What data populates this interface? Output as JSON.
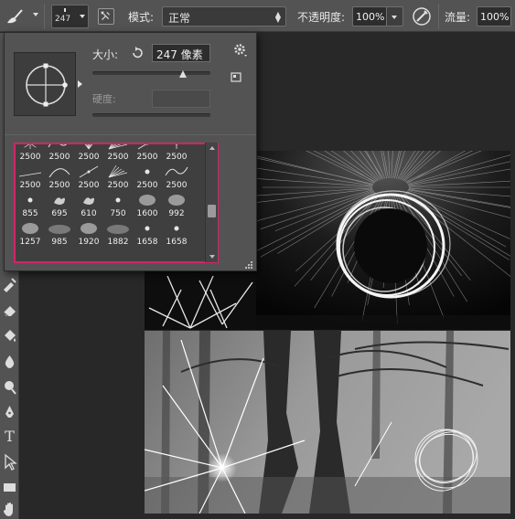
{
  "options_bar": {
    "tool_icon": "brush-icon",
    "brush_size": "247",
    "toggle_icon": "brush-panel-icon",
    "mode_label": "模式:",
    "mode_value": "正常",
    "opacity_label": "不透明度:",
    "opacity_value": "100%",
    "pressure_icon": "pressure-opacity-icon",
    "flow_label": "流量:",
    "flow_value": "100%"
  },
  "brush_picker": {
    "size_label": "大小:",
    "size_value": "247 像素",
    "size_level": 0.77,
    "hardness_label": "硬度:",
    "hardness_value": "",
    "brush_rows": [
      {
        "labels": [
          "2500",
          "2500",
          "2500",
          "2500",
          "2500",
          "2500"
        ],
        "strokes": [
          "burst",
          "wave",
          "rays",
          "fan",
          "spark",
          "star"
        ]
      },
      {
        "labels": [
          "2500",
          "2500",
          "2500",
          "2500",
          "2500",
          "2500"
        ],
        "strokes": [
          "streak",
          "arc",
          "spark",
          "fan",
          "dot",
          "wave"
        ]
      },
      {
        "labels": [
          "855",
          "695",
          "610",
          "750",
          "1600",
          "992"
        ],
        "strokes": [
          "dot",
          "splat",
          "splat",
          "dot",
          "cloud",
          "cloud"
        ]
      },
      {
        "labels": [
          "1257",
          "985",
          "1920",
          "1882",
          "1658",
          "1658"
        ],
        "strokes": [
          "cloud",
          "haze",
          "cloud",
          "haze",
          "dot",
          "dot"
        ]
      }
    ],
    "scroll_level": 0.6
  },
  "toolbar": {
    "tools": [
      "healing-brush-icon",
      "eraser-icon",
      "paint-bucket-icon",
      "blur-drop-icon",
      "dodge-icon",
      "pen-icon",
      "type-icon",
      "path-select-icon",
      "rectangle-icon",
      "hand-icon"
    ],
    "type_glyph": "T"
  },
  "colors": {
    "selection_border": "#d1246a",
    "panel_bg": "#535353",
    "canvas_bg": "#282828"
  }
}
